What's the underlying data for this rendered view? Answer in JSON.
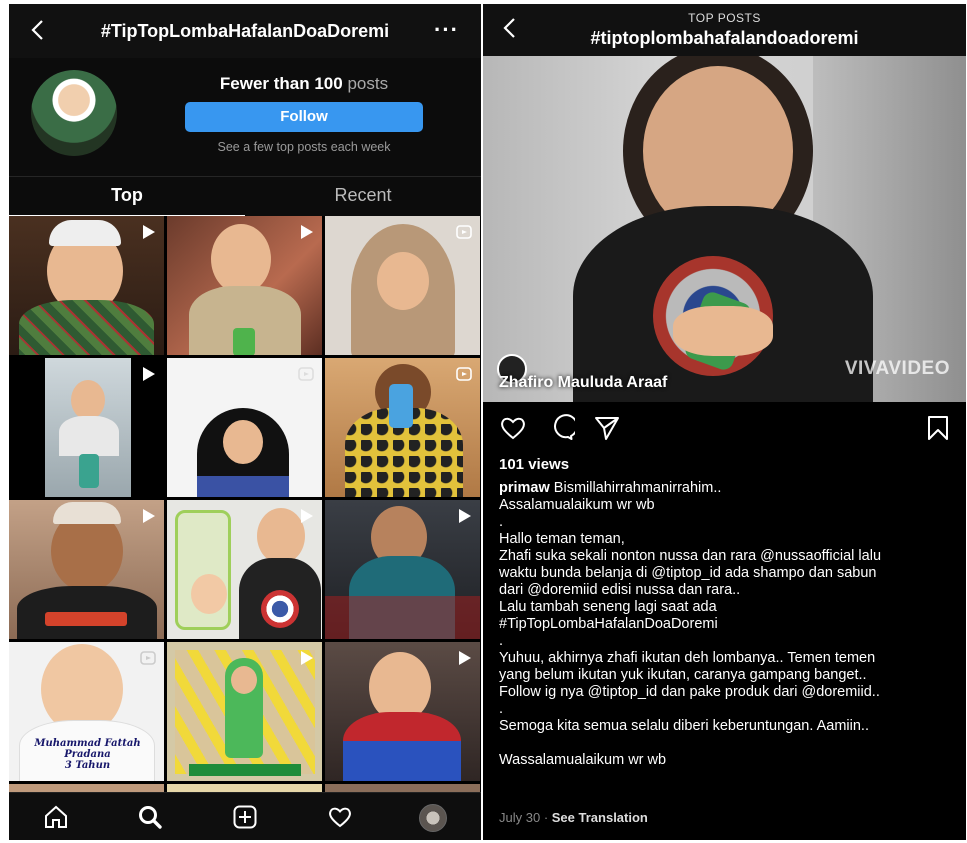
{
  "left": {
    "header": {
      "title": "#TipTopLombaHafalanDoaDoremi",
      "more_icon": "more-horizontal-icon",
      "back_icon": "chevron-left-icon"
    },
    "profile": {
      "count_bold": "Fewer than 100",
      "count_rest": "posts",
      "follow_label": "Follow",
      "hint": "See a few top posts each week"
    },
    "tabs": {
      "top": "Top",
      "recent": "Recent"
    },
    "grid": [
      {
        "badge": "play-icon",
        "caption": ""
      },
      {
        "badge": "play-icon",
        "caption": ""
      },
      {
        "badge": "reel-icon",
        "caption": ""
      },
      {
        "badge": "play-icon",
        "caption": ""
      },
      {
        "badge": "reel-icon",
        "caption": ""
      },
      {
        "badge": "reel-icon",
        "caption": ""
      },
      {
        "badge": "play-icon",
        "caption": ""
      },
      {
        "badge": "play-icon",
        "caption": ""
      },
      {
        "badge": "play-icon",
        "caption": ""
      },
      {
        "badge": "reel-icon",
        "caption": "Muhammad Fattah Pradana\n3 Tahun"
      },
      {
        "badge": "play-icon",
        "caption": ""
      },
      {
        "badge": "play-icon",
        "caption": ""
      }
    ],
    "nav": [
      "home-icon",
      "search-icon",
      "new-post-icon",
      "activity-heart-icon",
      "profile-avatar"
    ]
  },
  "right": {
    "header": {
      "subtitle": "TOP POSTS",
      "title": "#tiptoplombahafalandoadoremi"
    },
    "video": {
      "name_overlay": "Zhafiro Mauluda Araaf",
      "watermark": "VIVAVIDEO"
    },
    "views": "101 views",
    "caption": {
      "username": "primaw",
      "lines": [
        "Bismillahirrahmanirrahim..",
        "Assalamualaikum wr wb",
        ".",
        "Hallo teman teman,",
        "Zhafi suka sekali nonton nussa dan rara @nussaofficial lalu",
        "waktu bunda belanja di @tiptop_id ada shampo dan sabun",
        "dari @doremiid edisi nussa dan rara..",
        "Lalu tambah seneng lagi saat ada",
        "#TipTopLombaHafalanDoaDoremi",
        ".",
        "Yuhuu, akhirnya zhafi ikutan deh lombanya.. Temen temen",
        "yang belum ikutan yuk ikutan, caranya gampang banget..",
        "Follow ig nya @tiptop_id dan pake produk dari @doremiid..",
        ".",
        "Semoga kita semua selalu diberi keberuntungan. Aamiin..",
        "",
        "Wassalamualaikum wr wb"
      ]
    },
    "meta": {
      "date": "July 30",
      "sep": " · ",
      "translate": "See Translation"
    }
  },
  "colors": {
    "accent": "#3897f0",
    "bg": "#000000"
  }
}
